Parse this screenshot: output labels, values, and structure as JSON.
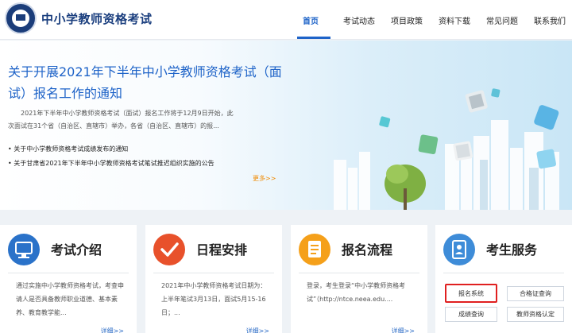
{
  "header": {
    "site_title": "中小学教师资格考试",
    "nav": [
      {
        "label": "首页",
        "active": true
      },
      {
        "label": "考试动态"
      },
      {
        "label": "项目政策"
      },
      {
        "label": "资料下载"
      },
      {
        "label": "常见问题"
      },
      {
        "label": "联系我们"
      }
    ]
  },
  "banner": {
    "headline": "关于开展2021年下半年中小学教师资格考试（面试）报名工作的通知",
    "summary": "2021年下半年中小学教师资格考试（面试）报名工作将于12月9日开始，此次面试在31个省（自治区、直辖市）举办，各省（自治区、直辖市）的报...",
    "notices": [
      "关于中小学教师资格考试成绩发布的通知",
      "关于甘肃省2021年下半年中小学教师资格考试笔试推迟组织实施的公告"
    ],
    "more": "更多>>"
  },
  "cards": [
    {
      "title": "考试介绍",
      "icon": "monitor-icon",
      "text": "通过实施中小学教师资格考试，考查申请人是否具备教师职业道德、基本素养、教育教学能...",
      "more": "详细>>"
    },
    {
      "title": "日程安排",
      "icon": "checkmark-icon",
      "text": "2021年中小学教师资格考试日期为：上半年笔试3月13日，面试5月15-16日；...",
      "more": "详细>>"
    },
    {
      "title": "报名流程",
      "icon": "document-icon",
      "text": "登录，考生登录“中小学教师资格考试”（http://ntce.neea.edu....",
      "more": "详细>>"
    },
    {
      "title": "考生服务",
      "icon": "contacts-icon",
      "buttons": [
        "报名系统",
        "合格证查询",
        "成绩查询",
        "教师资格认定"
      ]
    }
  ],
  "colors": {
    "brand": "#1a3e7e",
    "accent": "#1e63c8",
    "more": "#f08a00",
    "highlight": "#e02020"
  }
}
